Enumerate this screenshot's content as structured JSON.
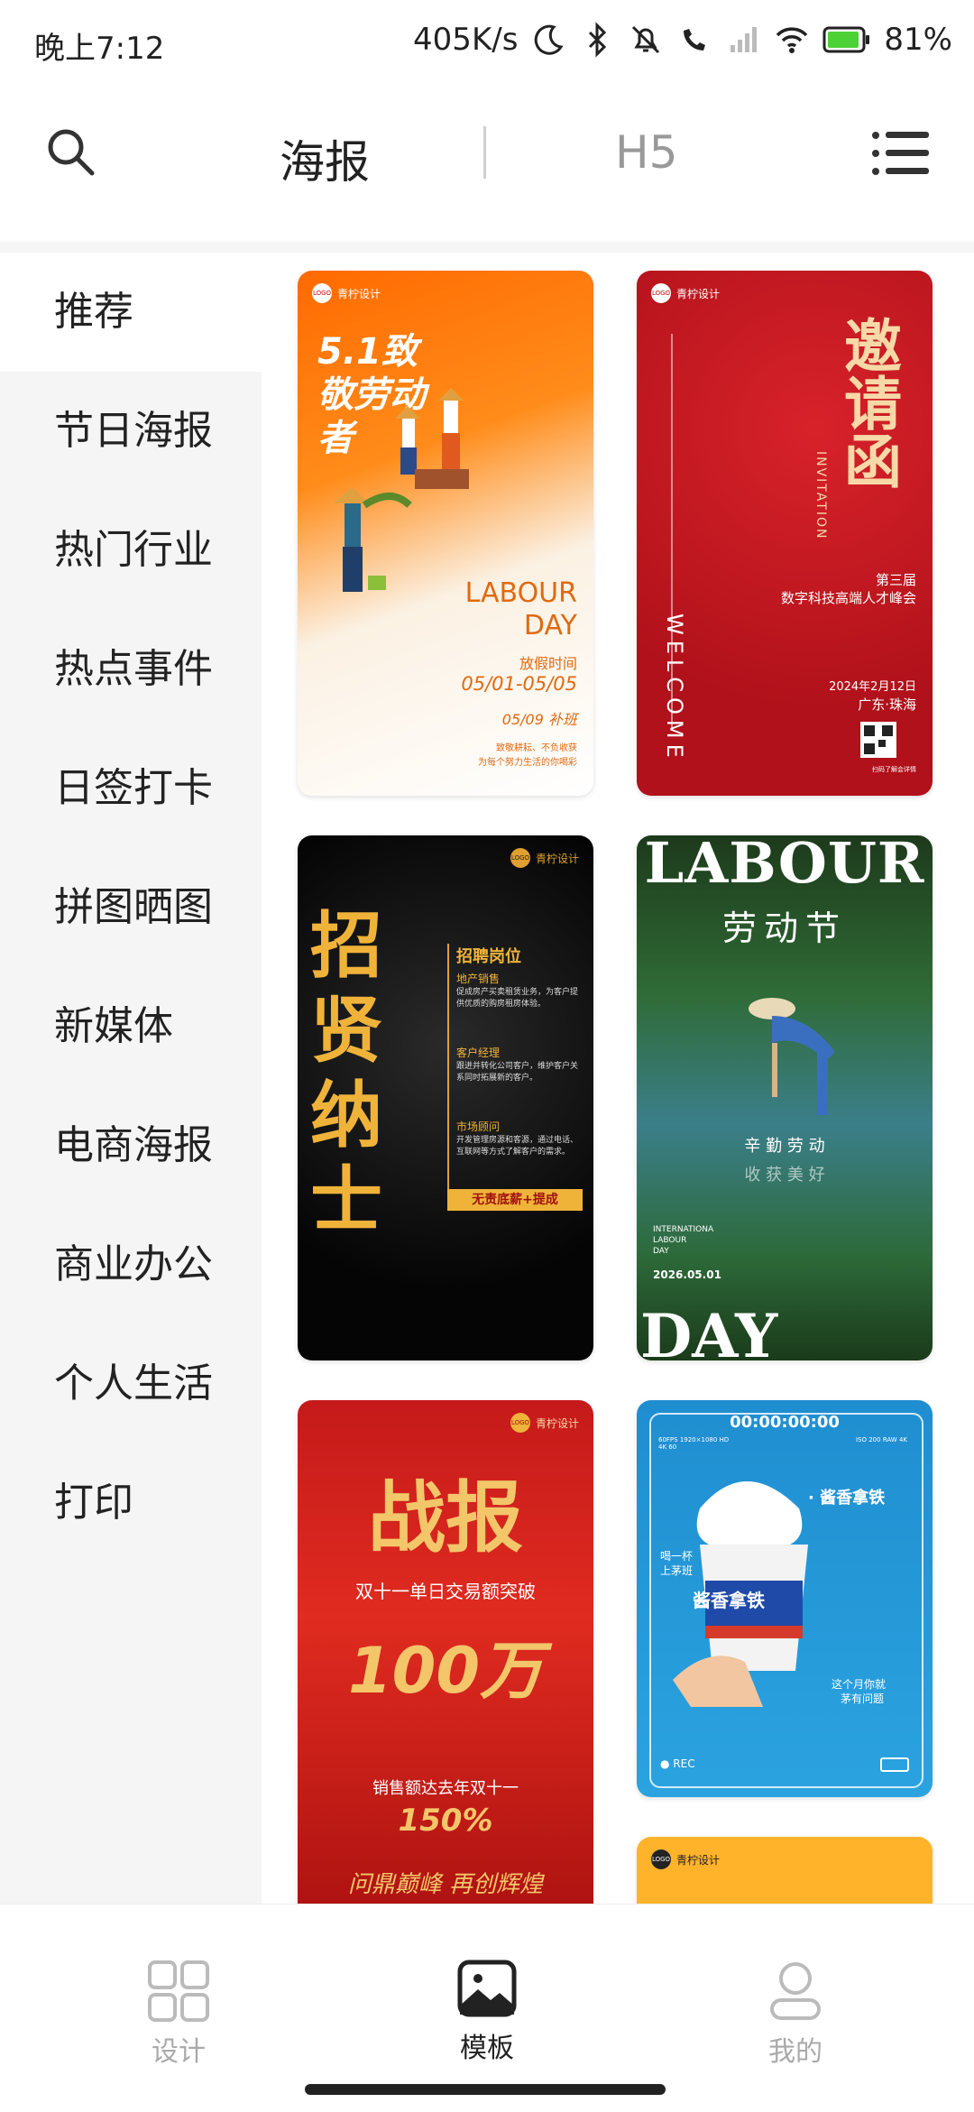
{
  "status_bar": {
    "time": "晚上7:12",
    "network_speed": "405K/s",
    "battery": "81%"
  },
  "header": {
    "tab_poster": "海报",
    "tab_h5": "H5"
  },
  "sidebar": {
    "items": [
      {
        "label": "推荐"
      },
      {
        "label": "节日海报"
      },
      {
        "label": "热门行业"
      },
      {
        "label": "热点事件"
      },
      {
        "label": "日签打卡"
      },
      {
        "label": "拼图晒图"
      },
      {
        "label": "新媒体"
      },
      {
        "label": "电商海报"
      },
      {
        "label": "商业办公"
      },
      {
        "label": "个人生活"
      },
      {
        "label": "打印"
      }
    ]
  },
  "templates": {
    "brand": "青柠设计",
    "logo_text": "LOGO",
    "card1": {
      "title": "5.1致敬劳动者",
      "sub_en": "LABOUR DAY",
      "holiday_label": "放假时间",
      "dates": "05/01-05/05",
      "makeup": "05/09 补班",
      "footer_line1": "致敬耕耘、不负收获",
      "footer_line2": "为每个努力生活的你喝彩"
    },
    "card2": {
      "title": "邀请函",
      "en": "INVITATION",
      "edition": "第三届",
      "summit": "数字科技高端人才峰会",
      "welcome": "WELCOME",
      "date": "2024年2月12日",
      "place": "广东·珠海",
      "qr_caption": "扫码了解会详情"
    },
    "card3": {
      "title": "招贤纳士",
      "heading": "招聘岗位",
      "job1": "地产销售",
      "job1_desc": "促成房产买卖租赁业务，为客户提供优质的购房租房体验。",
      "job2": "客户经理",
      "job2_desc": "跟进并转化公司客户，维护客户关系同时拓展新的客户。",
      "job3": "市场顾问",
      "job3_desc": "开发管理房源和客源，通过电话、互联网等方式了解客户的需求。",
      "banner": "无责底薪+提成"
    },
    "card4": {
      "title_en": "LABOUR",
      "title_cn": "劳动节",
      "motto1": "辛 勤 劳 动",
      "motto2": "收 获 美 好",
      "small1": "INTERNATIONA",
      "small2": "LABOUR",
      "small3": "DAY",
      "date": "2026.05.01",
      "bottom_en": "DAY"
    },
    "card5": {
      "title": "战报",
      "line1": "双十一单日交易额突破",
      "amount": "100万",
      "line2": "销售额达去年双十一",
      "percent": "150%",
      "slogan": "问鼎巅峰 再创辉煌"
    },
    "card6": {
      "timer": "00:00:00:00",
      "rec": "REC",
      "product": "· 酱香拿铁",
      "cup_text": "酱香拿铁",
      "side1": "喝一杯",
      "side2": "上茅班",
      "side3": "这个月你就",
      "side4": "茅有问题",
      "spec_left": "60FPS 1920×1080 HD 4K 60",
      "spec_right": "ISO 200 RAW 4K"
    },
    "card7": {
      "brand": "青柠设计"
    }
  },
  "bottom_nav": {
    "design": "设计",
    "templates": "模板",
    "mine": "我的"
  }
}
